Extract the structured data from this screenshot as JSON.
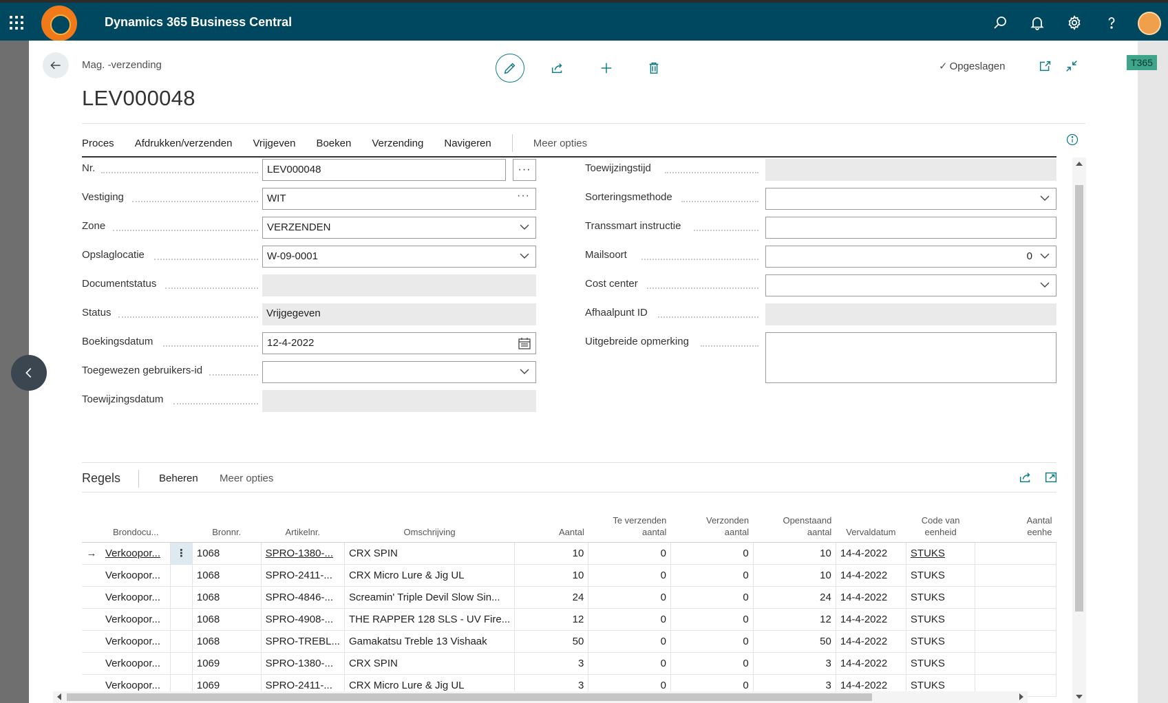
{
  "app": {
    "title": "Dynamics 365 Business Central",
    "env_badge": "T365"
  },
  "icons": {
    "waffle": "waffle-icon",
    "search": "search-icon",
    "bell": "bell-icon",
    "settings": "gear-icon",
    "help": "question-icon",
    "back": "arrow-left-icon",
    "edit": "pencil-icon",
    "share": "share-icon",
    "new": "plus-icon",
    "delete": "trash-icon",
    "open_new": "open-new-window-icon",
    "collapse": "collapse-icon",
    "info": "info-icon"
  },
  "colors": {
    "topbar": "#00485f",
    "accent": "#0e7c86",
    "brand_orange": "#f07a1a"
  },
  "page": {
    "breadcrumb": "Mag. -verzending",
    "title": "LEV000048",
    "saved_label": "Opgeslagen"
  },
  "menu": {
    "items": [
      "Proces",
      "Afdrukken/verzenden",
      "Vrijgeven",
      "Boeken",
      "Verzending",
      "Navigeren"
    ],
    "more": "Meer opties"
  },
  "fields_left": [
    {
      "label": "Nr.",
      "value": "LEV000048",
      "kind": "text-assist"
    },
    {
      "label": "Vestiging",
      "value": "WIT",
      "kind": "lookup"
    },
    {
      "label": "Zone",
      "value": "VERZENDEN",
      "kind": "dropdown"
    },
    {
      "label": "Opslaglocatie",
      "value": "W-09-0001",
      "kind": "dropdown"
    },
    {
      "label": "Documentstatus",
      "value": "",
      "kind": "readonly"
    },
    {
      "label": "Status",
      "value": "Vrijgegeven",
      "kind": "readonly"
    },
    {
      "label": "Boekingsdatum",
      "value": "12-4-2022",
      "kind": "date"
    },
    {
      "label": "Toegewezen gebruikers-id",
      "value": "",
      "kind": "dropdown"
    },
    {
      "label": "Toewijzingsdatum",
      "value": "",
      "kind": "readonly"
    }
  ],
  "fields_right": [
    {
      "label": "Toewijzingstijd",
      "value": "",
      "kind": "readonly"
    },
    {
      "label": "Sorteringsmethode",
      "value": "",
      "kind": "dropdown"
    },
    {
      "label": "Transsmart instructie",
      "value": "",
      "kind": "text"
    },
    {
      "label": "Mailsoort",
      "value": "0",
      "kind": "dropdown-num"
    },
    {
      "label": "Cost center",
      "value": "",
      "kind": "dropdown"
    },
    {
      "label": "Afhaalpunt ID",
      "value": "",
      "kind": "readonly"
    },
    {
      "label": "Uitgebreide opmerking",
      "value": "",
      "kind": "textarea"
    }
  ],
  "lines": {
    "title": "Regels",
    "actions": [
      "Beheren",
      "Meer opties"
    ],
    "columns": {
      "brondoc": "Brondocu...",
      "bronnr": "Bronnr.",
      "artikelnr": "Artikelnr.",
      "omschrijving": "Omschrijving",
      "aantal": "Aantal",
      "te_verzenden_1": "Te verzenden",
      "te_verzenden_2": "aantal",
      "verzonden_1": "Verzonden",
      "verzonden_2": "aantal",
      "openstaand_1": "Openstaand",
      "openstaand_2": "aantal",
      "vervaldatum": "Vervaldatum",
      "code_1": "Code van",
      "code_2": "eenheid",
      "aantal_eenh_1": "Aantal",
      "aantal_eenh_2": "eenhe"
    },
    "rows": [
      {
        "brondoc": "Verkoopor...",
        "bronnr": "1068",
        "artikelnr": "SPRO-1380-...",
        "omschrijving": "CRX SPIN",
        "aantal": "10",
        "te_verzenden": "0",
        "verzonden": "0",
        "openstaand": "10",
        "vervaldatum": "14-4-2022",
        "eenheid": "STUKS"
      },
      {
        "brondoc": "Verkoopor...",
        "bronnr": "1068",
        "artikelnr": "SPRO-2411-...",
        "omschrijving": "CRX Micro Lure & Jig UL",
        "aantal": "10",
        "te_verzenden": "0",
        "verzonden": "0",
        "openstaand": "10",
        "vervaldatum": "14-4-2022",
        "eenheid": "STUKS"
      },
      {
        "brondoc": "Verkoopor...",
        "bronnr": "1068",
        "artikelnr": "SPRO-4846-...",
        "omschrijving": "Screamin' Triple Devil Slow Sin...",
        "aantal": "24",
        "te_verzenden": "0",
        "verzonden": "0",
        "openstaand": "24",
        "vervaldatum": "14-4-2022",
        "eenheid": "STUKS"
      },
      {
        "brondoc": "Verkoopor...",
        "bronnr": "1068",
        "artikelnr": "SPRO-4908-...",
        "omschrijving": "THE RAPPER 128 SLS - UV Fire...",
        "aantal": "12",
        "te_verzenden": "0",
        "verzonden": "0",
        "openstaand": "12",
        "vervaldatum": "14-4-2022",
        "eenheid": "STUKS"
      },
      {
        "brondoc": "Verkoopor...",
        "bronnr": "1068",
        "artikelnr": "SPRO-TREBL...",
        "omschrijving": "Gamakatsu Treble 13 Vishaak",
        "aantal": "50",
        "te_verzenden": "0",
        "verzonden": "0",
        "openstaand": "50",
        "vervaldatum": "14-4-2022",
        "eenheid": "STUKS"
      },
      {
        "brondoc": "Verkoopor...",
        "bronnr": "1069",
        "artikelnr": "SPRO-1380-...",
        "omschrijving": "CRX SPIN",
        "aantal": "3",
        "te_verzenden": "0",
        "verzonden": "0",
        "openstaand": "3",
        "vervaldatum": "14-4-2022",
        "eenheid": "STUKS"
      },
      {
        "brondoc": "Verkoopor...",
        "bronnr": "1069",
        "artikelnr": "SPRO-2411-...",
        "omschrijving": "CRX Micro Lure & Jig UL",
        "aantal": "3",
        "te_verzenden": "0",
        "verzonden": "0",
        "openstaand": "3",
        "vervaldatum": "14-4-2022",
        "eenheid": "STUKS"
      }
    ]
  }
}
